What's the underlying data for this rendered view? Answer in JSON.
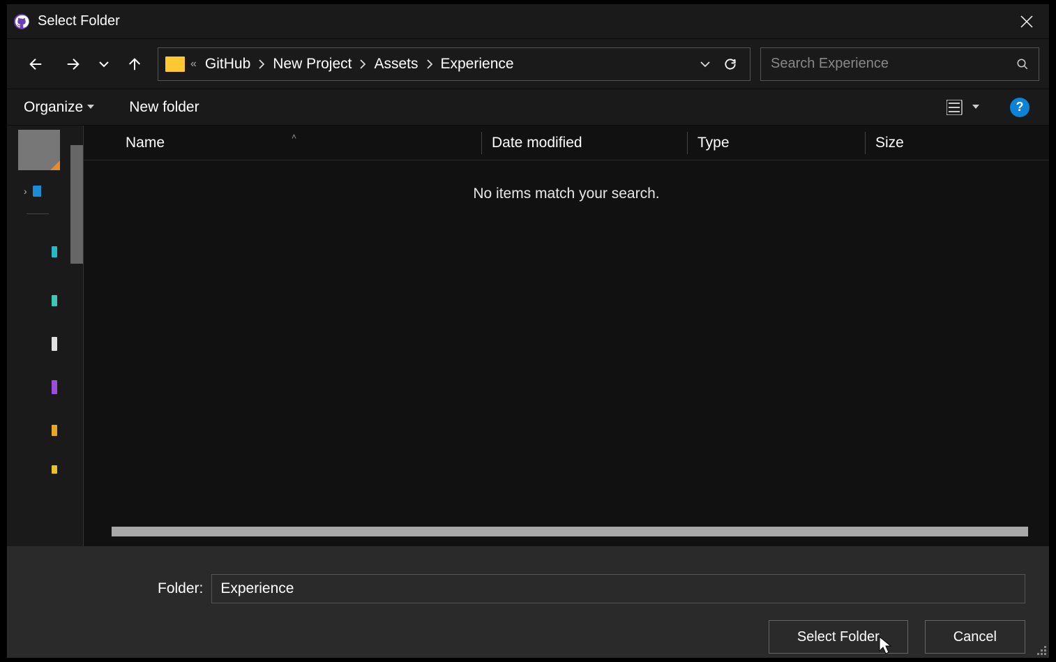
{
  "titlebar": {
    "title": "Select Folder"
  },
  "breadcrumb": {
    "segments": [
      "GitHub",
      "New Project",
      "Assets",
      "Experience"
    ]
  },
  "search": {
    "placeholder": "Search Experience"
  },
  "toolbar": {
    "organize": "Organize",
    "new_folder": "New folder"
  },
  "columns": {
    "name": "Name",
    "date": "Date modified",
    "type": "Type",
    "size": "Size"
  },
  "list": {
    "empty_message": "No items match your search."
  },
  "footer": {
    "label": "Folder:",
    "value": "Experience",
    "select_button": "Select Folder",
    "cancel_button": "Cancel"
  }
}
